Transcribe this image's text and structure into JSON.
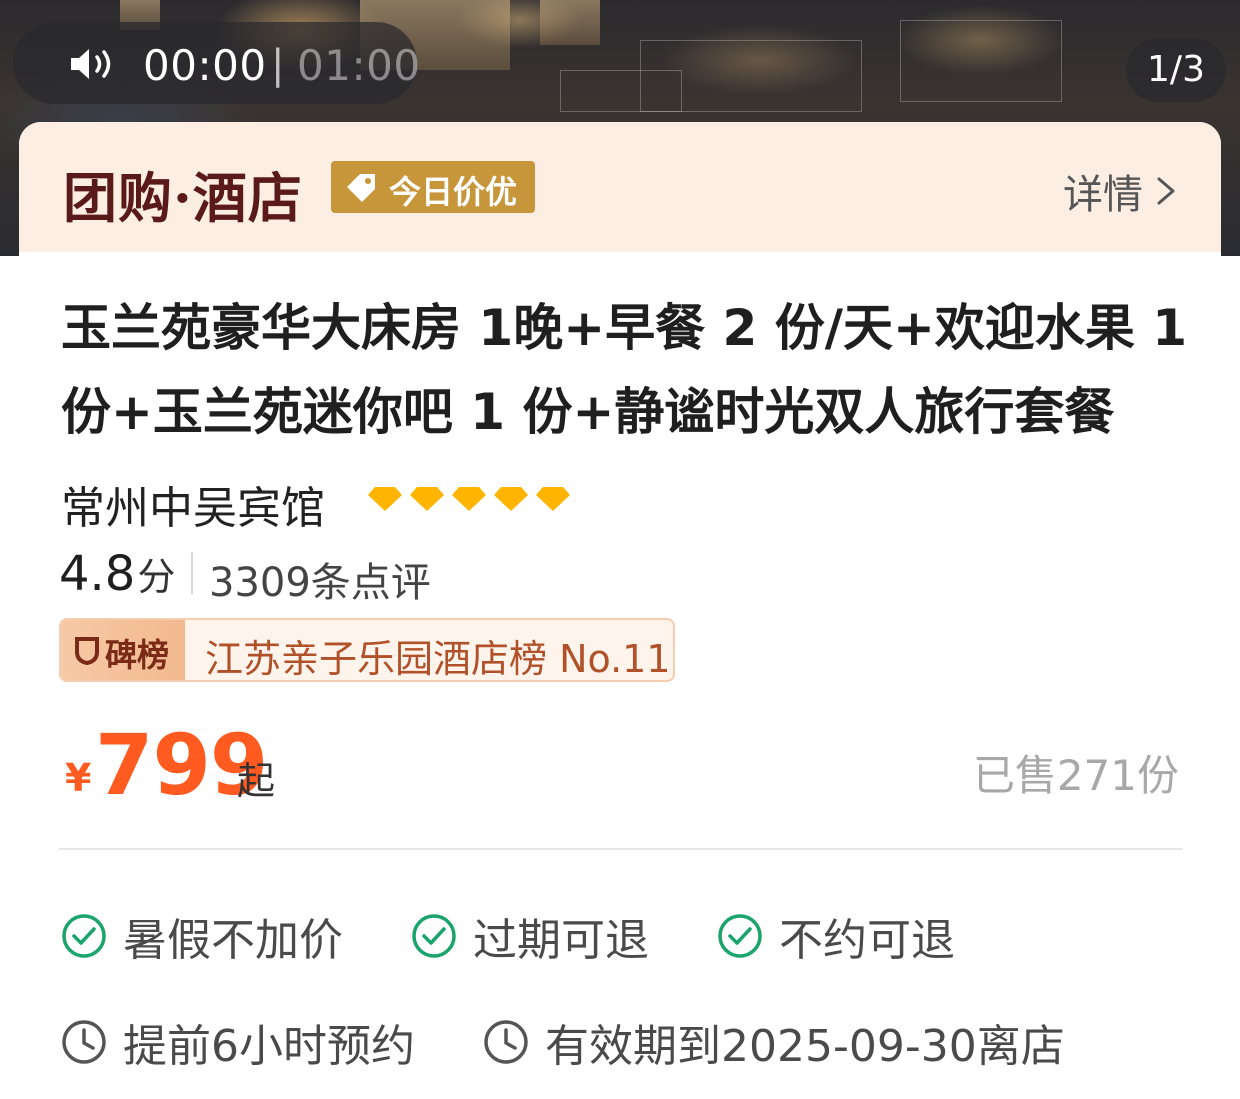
{
  "player": {
    "current_time": "00:00",
    "separator": "|",
    "total_time": "01:00",
    "page_indicator": "1/3"
  },
  "header": {
    "brand_title": "团购·酒店",
    "deal_tag": "今日价优",
    "details_link": "详情"
  },
  "product": {
    "title": "玉兰苑豪华大床房 1晚+早餐 2 份/天+欢迎水果 1 份+玉兰苑迷你吧 1 份+静谧时光双人旅行套餐",
    "hotel_name": "常州中吴宾馆",
    "diamond_rating": 5,
    "rating_score": "4.8",
    "rating_unit": "分",
    "review_count": "3309条点评",
    "rank_label": "碑榜",
    "rank_text": "江苏亲子乐园酒店榜 No.11",
    "price_currency": "¥",
    "price_value": "799",
    "price_suffix": "起",
    "sold_count": "已售271份"
  },
  "features": [
    {
      "label": "暑假不加价",
      "icon": "check-circle-icon"
    },
    {
      "label": "过期可退",
      "icon": "check-circle-icon"
    },
    {
      "label": "不约可退",
      "icon": "check-circle-icon"
    }
  ],
  "info": [
    {
      "label": "提前6小时预约",
      "icon": "clock-icon"
    },
    {
      "label": "有效期到2025-09-30离店",
      "icon": "clock-icon"
    }
  ],
  "colors": {
    "brand": "#5a1a1a",
    "tag": "#c8963a",
    "price": "#ff5a1f",
    "check": "#1aa36b",
    "diamond": "#ffb400"
  }
}
